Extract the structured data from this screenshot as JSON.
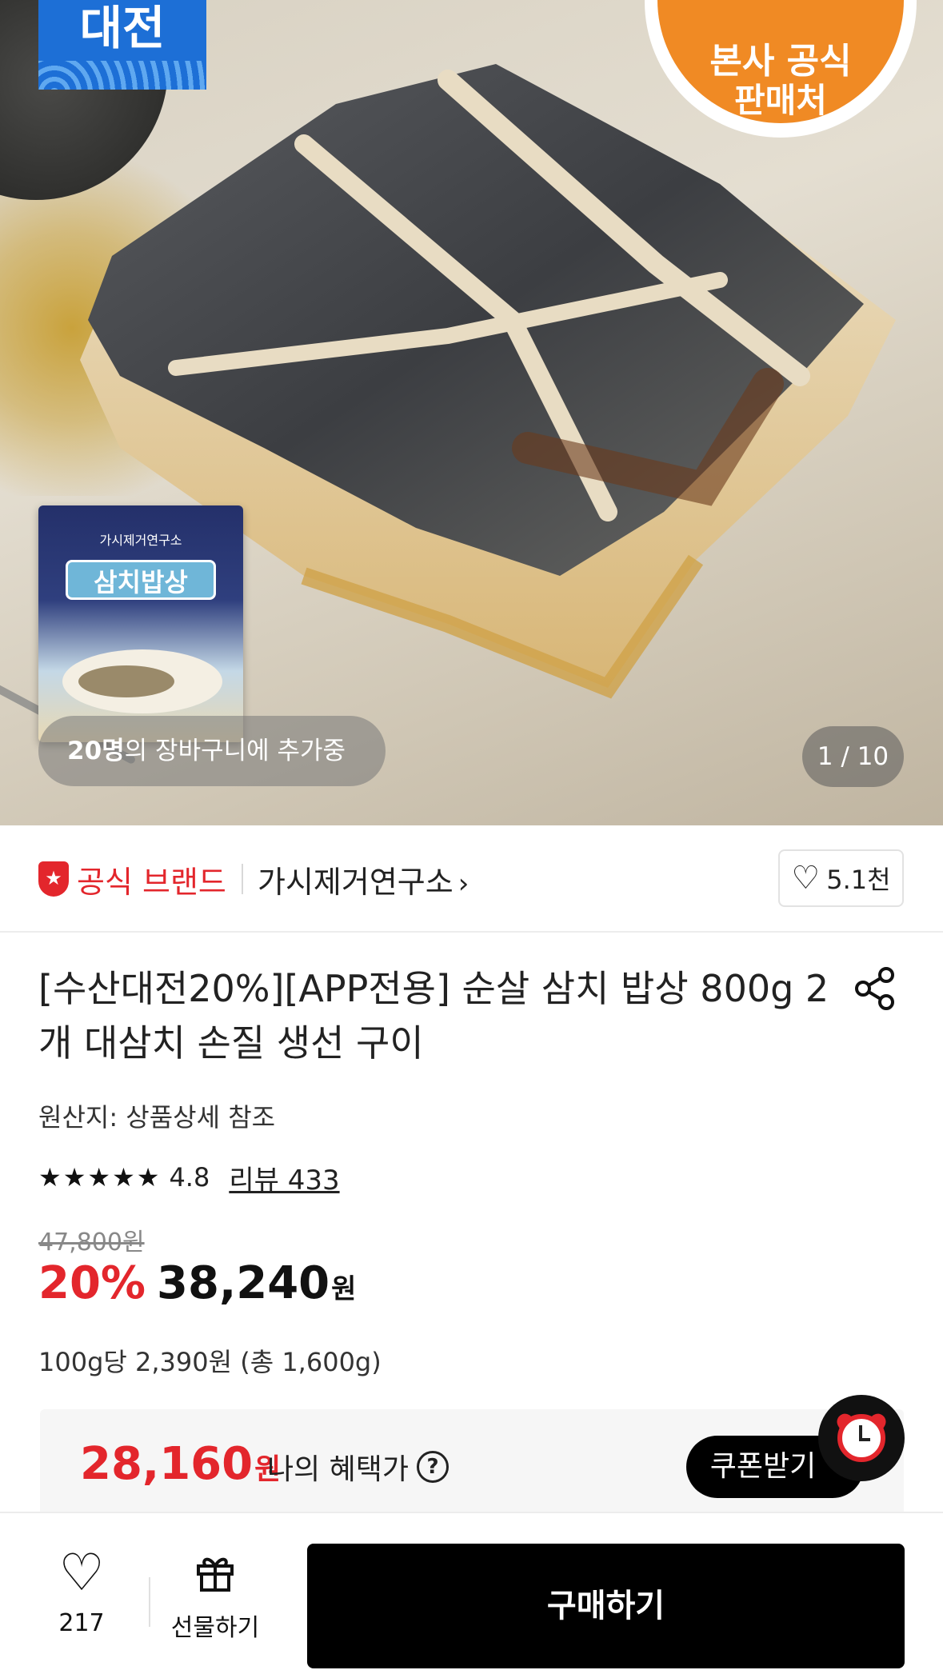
{
  "hero": {
    "badge_event": "대전",
    "badge_official_line1": "본사 공식",
    "badge_official_line2": "판매처",
    "package_small": "가시제거연구소",
    "package_title": "삼치밥상",
    "cart_count": "20명",
    "cart_text": "의 장바구니에 추가중",
    "image_counter": "1 / 10"
  },
  "brand": {
    "official_label": "공식 브랜드",
    "store_name": "가시제거연구소",
    "like_count": "5.1천"
  },
  "product": {
    "title": "[수산대전20%][APP전용] 순살 삼치 밥상 800g 2개 대삼치 손질 생선 구이",
    "origin": "원산지: 상품상세 참조",
    "rating_stars": "★★★★★",
    "rating_value": "4.8",
    "review_link": "리뷰 433",
    "original_price": "47,800원",
    "discount_percent": "20%",
    "sale_price": "38,240",
    "currency": "원",
    "unit_price": "100g당 2,390원 (총 1,600g)"
  },
  "benefit": {
    "price": "28,160",
    "currency": "원",
    "label": "나의 혜택가",
    "help_icon": "?",
    "coupon_button": "쿠폰받기"
  },
  "bottom_bar": {
    "wish_count": "217",
    "gift_label": "선물하기",
    "buy_label": "구매하기"
  },
  "colors": {
    "accent_red": "#e3262c",
    "badge_blue": "#1d6fd6",
    "badge_orange": "#f08a24",
    "button_black": "#000000"
  }
}
